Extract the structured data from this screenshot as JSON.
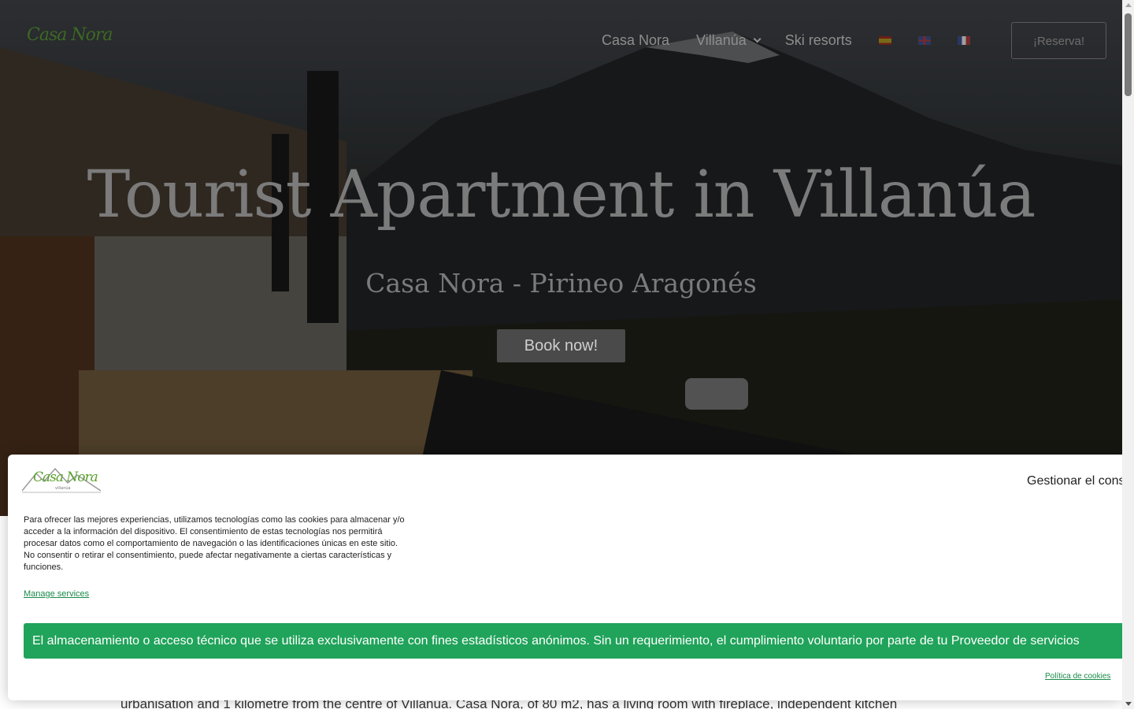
{
  "header": {
    "logo_text": "Casa Nora",
    "nav": [
      {
        "label": "Casa Nora"
      },
      {
        "label": "Villanúa"
      },
      {
        "label": "Ski resorts"
      }
    ],
    "reserve_label": "¡Reserva!"
  },
  "hero": {
    "title": "Tourist Apartment in Villanúa",
    "subtitle": "Casa Nora - Pirineo Aragonés",
    "cta_label": "Book now!"
  },
  "body": {
    "partial_text": "urbanisation and 1 kilometre from the centre of Villanúa. Casa Nora, of 80 m2, has a living room with fireplace, independent kitchen"
  },
  "cookie_banner": {
    "logo_text": "Casa Nora",
    "logo_sub": "villanúa",
    "title": "Gestionar el consentimiento",
    "text": "Para ofrecer las mejores experiencias, utilizamos tecnologías como las cookies para almacenar y/o acceder a la información del dispositivo. El consentimiento de estas tecnologías nos permitirá procesar datos como el comportamiento de navegación o las identificaciones únicas en este sitio. No consentir o retirar el consentimiento, puede afectar negativamente a ciertas características y funciones.",
    "manage_label": "Manage services",
    "green_text": "El almacenamiento o acceso técnico que se utiliza exclusivamente con fines estadísticos anónimos. Sin un requerimiento, el cumplimiento voluntario por parte de tu Proveedor de servicios",
    "policy_label": "Política de cookies",
    "accent_color": "#20a35a"
  }
}
